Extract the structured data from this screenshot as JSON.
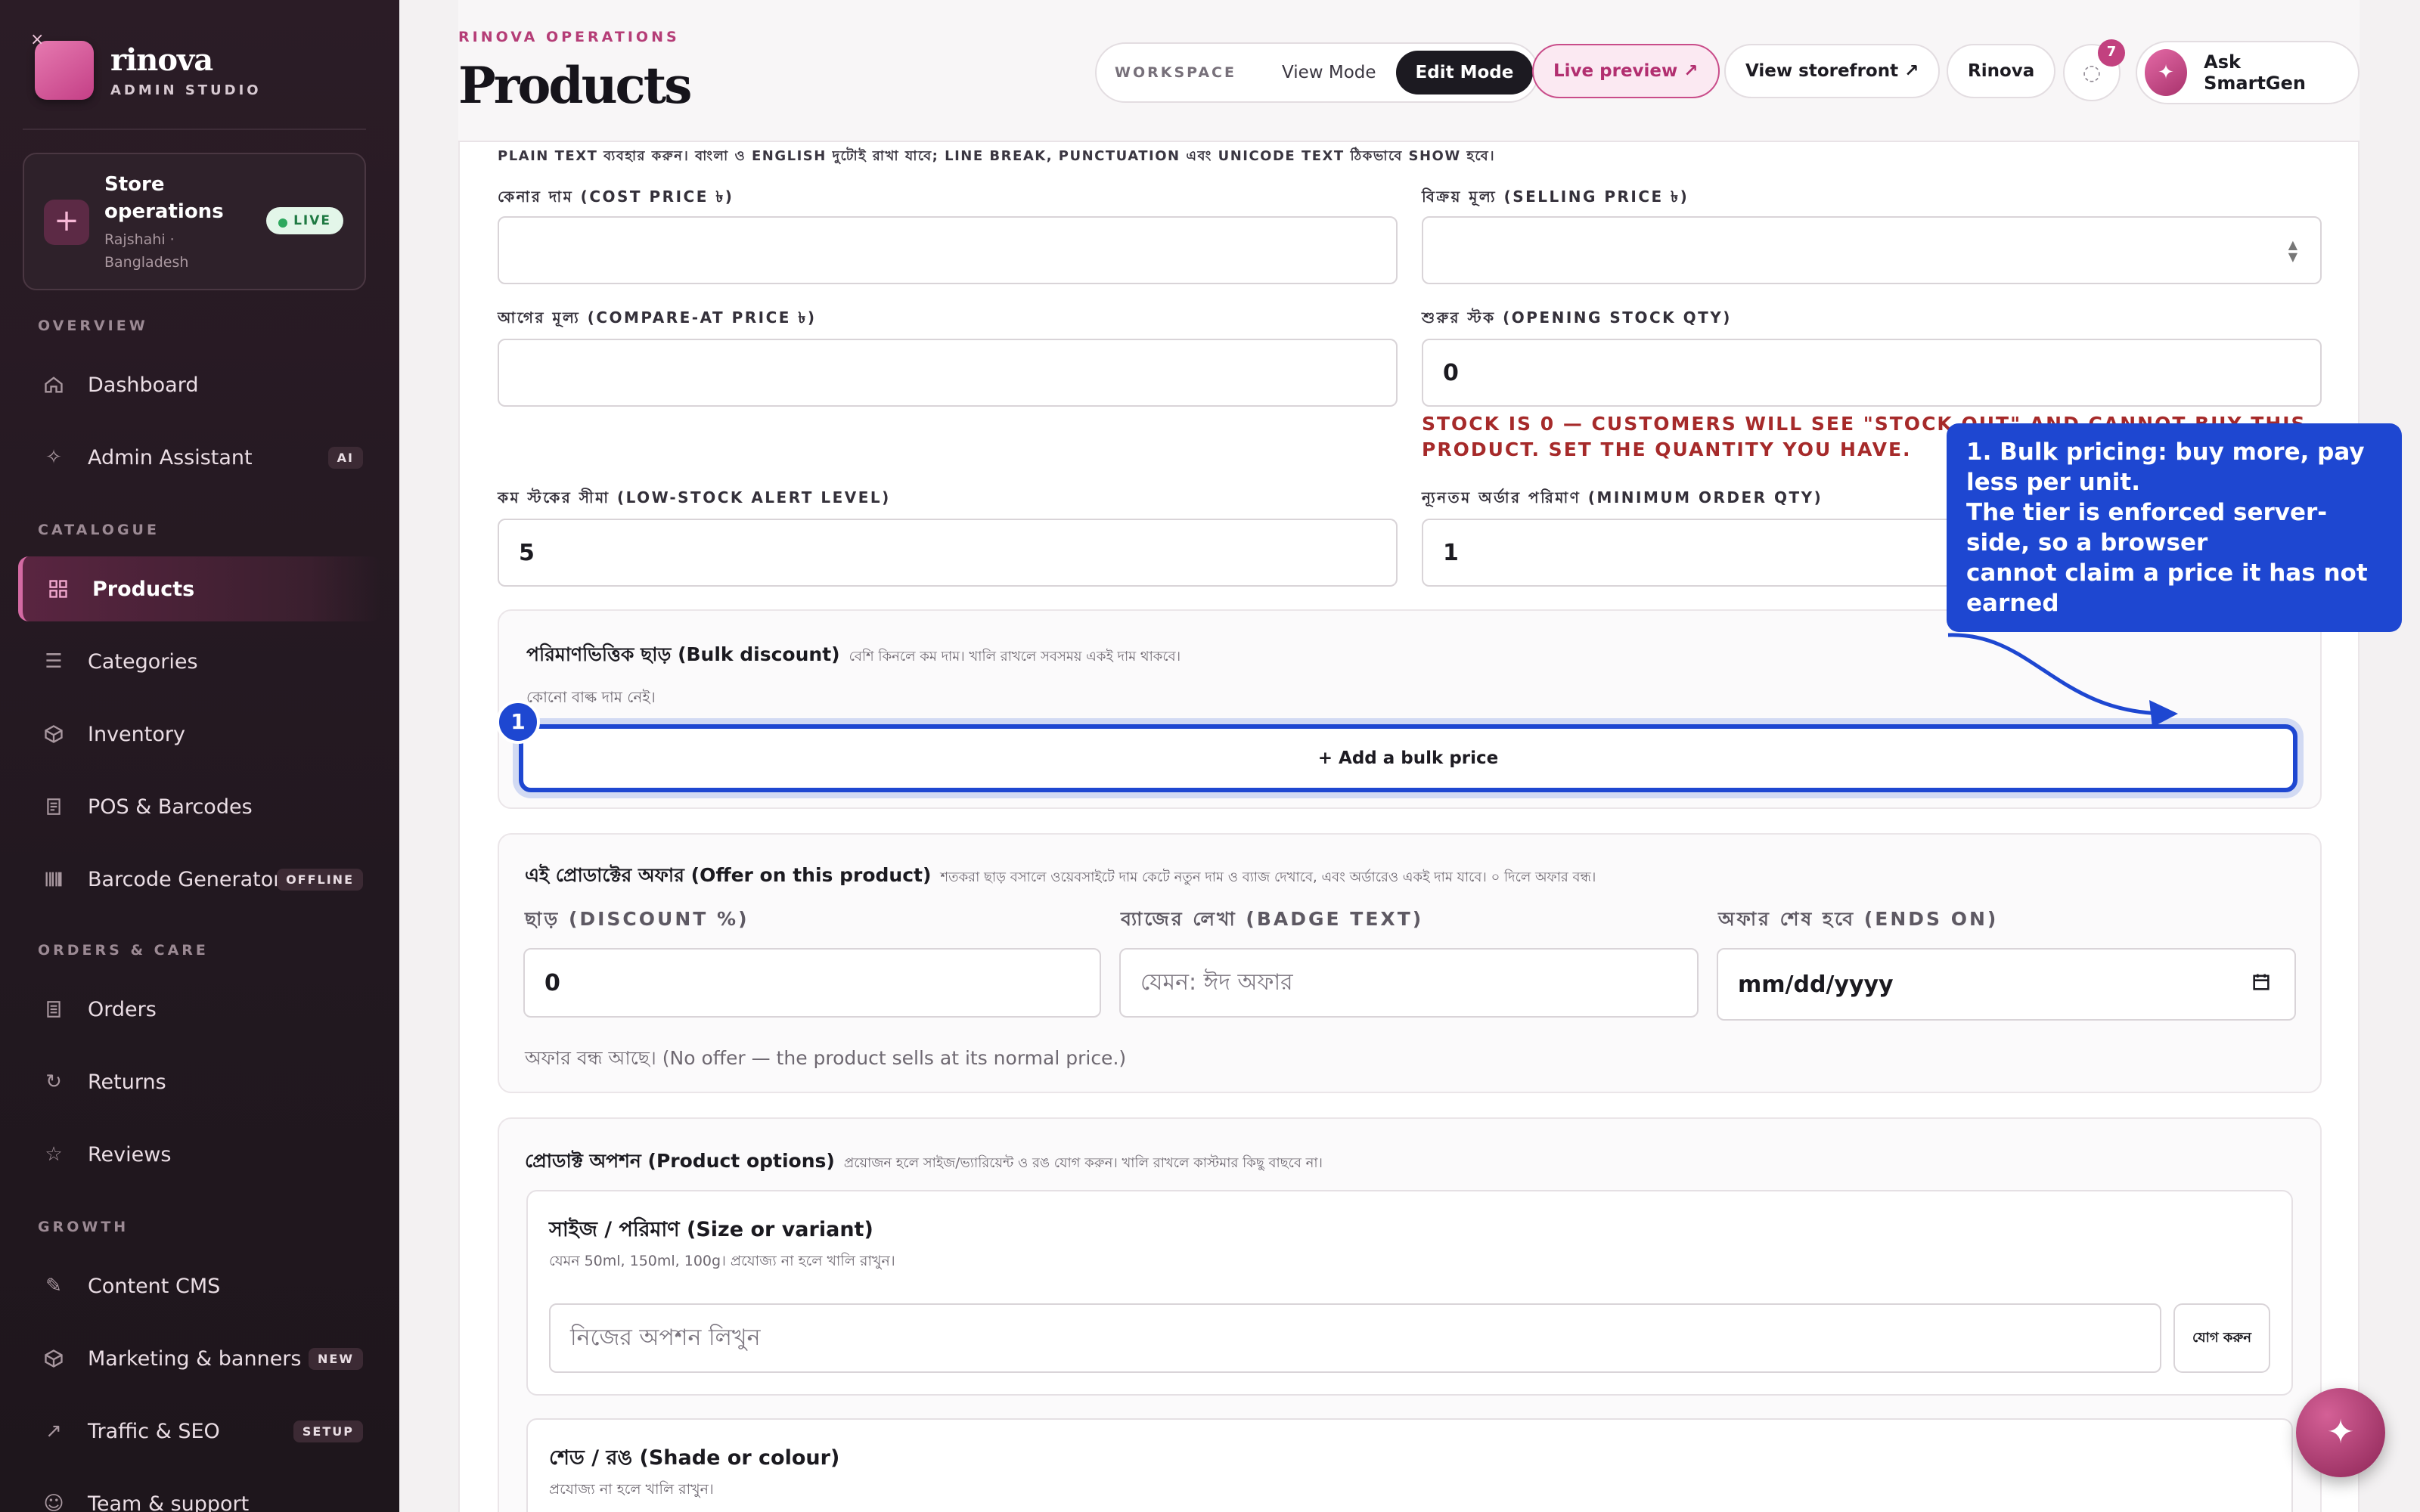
{
  "brand": {
    "name": "rinova",
    "subtitle": "ADMIN STUDIO"
  },
  "store": {
    "title": "Store operations",
    "location": "Rajshahi · Bangladesh",
    "badge": "LIVE"
  },
  "sections": {
    "overview": "OVERVIEW",
    "catalogue": "CATALOGUE",
    "orders": "ORDERS & CARE",
    "growth": "GROWTH"
  },
  "nav": {
    "dashboard": "Dashboard",
    "assistant": "Admin Assistant",
    "assistant_badge": "AI",
    "products": "Products",
    "categories": "Categories",
    "inventory": "Inventory",
    "pos": "POS & Barcodes",
    "barcode": "Barcode Generator",
    "barcode_badge": "OFFLINE",
    "orders": "Orders",
    "returns": "Returns",
    "reviews": "Reviews",
    "cms": "Content CMS",
    "marketing": "Marketing & banners",
    "marketing_badge": "NEW",
    "traffic": "Traffic & SEO",
    "traffic_badge": "SETUP",
    "team": "Team & support"
  },
  "header": {
    "eyebrow": "RINOVA OPERATIONS",
    "title": "Products",
    "workspace_label": "WORKSPACE",
    "view_mode": "View Mode",
    "edit_mode": "Edit Mode",
    "live_preview": "Live preview ↗",
    "view_storefront": "View storefront ↗",
    "account": "Rinova",
    "notif_count": "7",
    "ask": "Ask SmartGen"
  },
  "form": {
    "hint": "PLAIN TEXT ব্যবহার করুন। বাংলা ও ENGLISH দুটোই রাখা যাবে; LINE BREAK, PUNCTUATION এবং UNICODE TEXT ঠিকভাবে SHOW হবে।",
    "cost_label": "কেনার দাম (COST PRICE ৳)",
    "cost_value": "",
    "selling_label": "বিক্রয় মূল্য (SELLING PRICE ৳)",
    "selling_value": "",
    "compare_label": "আগের মূল্য (COMPARE-AT PRICE ৳)",
    "compare_value": "",
    "stock_label": "শুরুর স্টক (OPENING STOCK QTY)",
    "stock_value": "0",
    "stock_warning": "STOCK IS 0 — CUSTOMERS WILL SEE \"STOCK OUT\" AND CANNOT BUY THIS PRODUCT. SET THE QUANTITY YOU HAVE.",
    "low_label": "কম স্টকের সীমা (LOW-STOCK ALERT LEVEL)",
    "low_value": "5",
    "min_label": "ন্যূনতম অর্ডার পরিমাণ (MINIMUM ORDER QTY)",
    "min_value": "1"
  },
  "bulk": {
    "title": "পরিমাণভিত্তিক ছাড় (Bulk discount)",
    "hint": "বেশি কিনলে কম দাম। খালি রাখলে সবসময় একই দাম থাকবে।",
    "empty": "কোনো বাল্ক দাম নেই।",
    "add": "+ Add a bulk price",
    "step": "1"
  },
  "callout": {
    "text": "1. Bulk pricing: buy more, pay less per unit.\nThe tier is enforced server-side, so a browser\ncannot claim a price it has not earned"
  },
  "offer": {
    "title": "এই প্রোডাক্টের অফার (Offer on this product)",
    "hint": "শতকরা ছাড় বসালে ওয়েবসাইটে দাম কেটে নতুন দাম ও ব্যাজ দেখাবে, এবং অর্ডারেও একই দাম যাবে। ০ দিলে অফার বন্ধ।",
    "discount_label": "ছাড় (DISCOUNT %)",
    "discount_value": "0",
    "badge_label": "ব্যাজের লেখা (BADGE TEXT)",
    "badge_placeholder": "যেমন: ঈদ অফার",
    "ends_label": "অফার শেষ হবে (ENDS ON)",
    "ends_placeholder": "mm/dd/yyyy",
    "status": "অফার বন্ধ আছে। (No offer — the product sells at its normal price.)"
  },
  "options": {
    "title": "প্রোডাক্ট অপশন (Product options)",
    "hint": "প্রয়োজন হলে সাইজ/ভ্যারিয়েন্ট ও রঙ যোগ করুন। খালি রাখলে কাস্টমার কিছু বাছবে না।",
    "size_title": "সাইজ / পরিমাণ (Size or variant)",
    "size_hint": "যেমন 50ml, 150ml, 100g। প্রযোজ্য না হলে খালি রাখুন।",
    "size_placeholder": "নিজের অপশন লিখুন",
    "add_button": "যোগ করুন",
    "shade_title": "শেড / রঙ (Shade or colour)",
    "shade_hint": "প্রযোজ্য না হলে খালি রাখুন।"
  }
}
